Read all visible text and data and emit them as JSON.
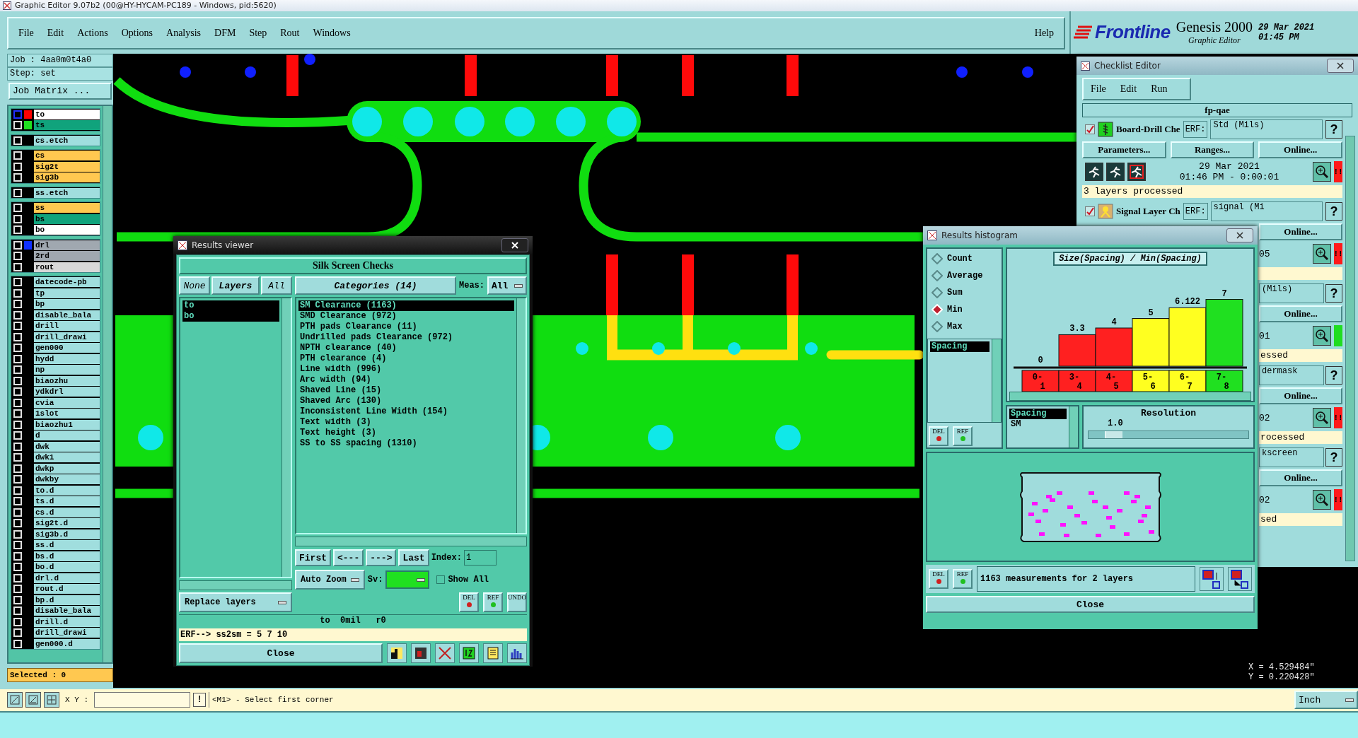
{
  "window": {
    "title": "Graphic Editor 9.07b2 (00@HY-HYCAM-PC189 - Windows, pid:5620)"
  },
  "menu": [
    "File",
    "Edit",
    "Actions",
    "Options",
    "Analysis",
    "DFM",
    "Step",
    "Rout",
    "Windows"
  ],
  "help_menu": "Help",
  "brand": {
    "logo": "Frontline",
    "product": "Genesis 2000",
    "subtitle": "Graphic Editor",
    "date": "29 Mar 2021",
    "time": "01:45 PM"
  },
  "job": {
    "job": "Job : 4aa0m0t4a0",
    "step": "Step: set",
    "matrix_button": "Job Matrix ..."
  },
  "layer_groups": [
    {
      "layers": [
        {
          "name": "to",
          "color": "#ffffff",
          "swatch": {
            "color": "#ff0000"
          },
          "selected": true
        },
        {
          "name": "ts",
          "color": "#10a37c",
          "swatch": {
            "color": "#20e020"
          },
          "selected": false
        }
      ]
    },
    {
      "layers": [
        {
          "name": "cs.etch",
          "color": "#a0dede",
          "selected": false
        }
      ]
    },
    {
      "layers": [
        {
          "name": "cs",
          "color": "#ffc850",
          "selected": false
        },
        {
          "name": "sig2t",
          "color": "#ffc850",
          "selected": false
        },
        {
          "name": "sig3b",
          "color": "#ffc850",
          "selected": false
        }
      ]
    },
    {
      "layers": [
        {
          "name": "ss.etch",
          "color": "#a0dede",
          "selected": false
        }
      ]
    },
    {
      "layers": [
        {
          "name": "ss",
          "color": "#ffc850",
          "selected": false
        },
        {
          "name": "bs",
          "color": "#10a37c",
          "selected": false
        },
        {
          "name": "bo",
          "color": "#ffffff",
          "selected": false
        }
      ]
    },
    {
      "layers": [
        {
          "name": "drl",
          "color": "#a0a8b0",
          "swatch": {
            "color": "#1030ff"
          },
          "selected": false
        },
        {
          "name": "2rd",
          "color": "#a0a8b0",
          "selected": false
        },
        {
          "name": "rout",
          "color": "#d8d8d8",
          "selected": false
        }
      ]
    },
    {
      "layers": [
        {
          "name": "datecode-pb",
          "color": "#a0dede",
          "selected": false
        },
        {
          "name": "tp",
          "color": "#a0dede",
          "selected": false
        },
        {
          "name": "bp",
          "color": "#a0dede",
          "selected": false
        },
        {
          "name": "disable_bala",
          "color": "#a0dede",
          "selected": false
        },
        {
          "name": "drill",
          "color": "#a0dede",
          "selected": false
        },
        {
          "name": "drill_drawi",
          "color": "#a0dede",
          "selected": false
        },
        {
          "name": "gen000",
          "color": "#a0dede",
          "selected": false
        },
        {
          "name": "hydd",
          "color": "#a0dede",
          "selected": false
        },
        {
          "name": "np",
          "color": "#a0dede",
          "selected": false
        },
        {
          "name": "biaozhu",
          "color": "#a0dede",
          "selected": false
        },
        {
          "name": "ydkdrl",
          "color": "#a0dede",
          "selected": false
        },
        {
          "name": "cvia",
          "color": "#a0dede",
          "selected": false
        },
        {
          "name": "1slot",
          "color": "#a0dede",
          "selected": false
        },
        {
          "name": "biaozhu1",
          "color": "#a0dede",
          "selected": false
        },
        {
          "name": "d",
          "color": "#a0dede",
          "selected": false
        },
        {
          "name": "dwk",
          "color": "#a0dede",
          "selected": false
        },
        {
          "name": "dwk1",
          "color": "#a0dede",
          "selected": false
        },
        {
          "name": "dwkp",
          "color": "#a0dede",
          "selected": false
        },
        {
          "name": "dwkby",
          "color": "#a0dede",
          "selected": false
        },
        {
          "name": "to.d",
          "color": "#a0dede",
          "selected": false
        },
        {
          "name": "ts.d",
          "color": "#a0dede",
          "selected": false
        },
        {
          "name": "cs.d",
          "color": "#a0dede",
          "selected": false
        },
        {
          "name": "sig2t.d",
          "color": "#a0dede",
          "selected": false
        },
        {
          "name": "sig3b.d",
          "color": "#a0dede",
          "selected": false
        },
        {
          "name": "ss.d",
          "color": "#a0dede",
          "selected": false
        },
        {
          "name": "bs.d",
          "color": "#a0dede",
          "selected": false
        },
        {
          "name": "bo.d",
          "color": "#a0dede",
          "selected": false
        },
        {
          "name": "drl.d",
          "color": "#a0dede",
          "selected": false
        },
        {
          "name": "rout.d",
          "color": "#a0dede",
          "selected": false
        },
        {
          "name": "bp.d",
          "color": "#a0dede",
          "selected": false
        },
        {
          "name": "disable_bala",
          "color": "#a0dede",
          "selected": false
        },
        {
          "name": "drill.d",
          "color": "#a0dede",
          "selected": false
        },
        {
          "name": "drill_drawi",
          "color": "#a0dede",
          "selected": false
        },
        {
          "name": "gen000.d",
          "color": "#a0dede",
          "selected": false
        }
      ]
    }
  ],
  "selected_count": "Selected : 0",
  "coordinates": [
    "X = 4.529484\"",
    "Y = 0.220428\""
  ],
  "results_viewer": {
    "title": "Results viewer",
    "heading": "Silk Screen Checks",
    "layer_buttons": [
      "None",
      "Layers",
      "All"
    ],
    "layers": [
      {
        "name": "to",
        "selected": true
      },
      {
        "name": "bo",
        "selected": true
      }
    ],
    "categories_button": "Categories (14)",
    "meas_label": "Meas:",
    "meas_value": "All",
    "categories": [
      {
        "label": "SM Clearance (1163)",
        "selected": true
      },
      {
        "label": "SMD Clearance (972)",
        "selected": false
      },
      {
        "label": "PTH pads Clearance (11)",
        "selected": false
      },
      {
        "label": "Undrilled pads Clearance (972)",
        "selected": false
      },
      {
        "label": "NPTH clearance (40)",
        "selected": false
      },
      {
        "label": "PTH clearance (4)",
        "selected": false
      },
      {
        "label": "Line width (996)",
        "selected": false
      },
      {
        "label": "Arc width (94)",
        "selected": false
      },
      {
        "label": "Shaved Line (15)",
        "selected": false
      },
      {
        "label": "Shaved Arc (130)",
        "selected": false
      },
      {
        "label": "Inconsistent Line Width (154)",
        "selected": false
      },
      {
        "label": "Text width (3)",
        "selected": false
      },
      {
        "label": "Text height (3)",
        "selected": false
      },
      {
        "label": "SS to SS spacing (1310)",
        "selected": false
      }
    ],
    "nav_buttons": [
      "First",
      "<---",
      "--->",
      "Last"
    ],
    "index_label": "Index:",
    "index_value": "1",
    "zoom_mode": "Auto Zoom",
    "sv": {
      "label": "Sv:",
      "color": "#20e020"
    },
    "show_all": {
      "label": "Show All",
      "checked": false
    },
    "replace_mode": "Replace layers",
    "tool_buttons": [
      "DEL",
      "REF",
      "UNDO"
    ],
    "info_line": "to  0mil   r0",
    "erf_line": "ERF--> ss2sm = 5 7 10",
    "close_button": "Close"
  },
  "histogram": {
    "title": "Results histogram",
    "modes": [
      {
        "label": "Count",
        "selected": false
      },
      {
        "label": "Average",
        "selected": false
      },
      {
        "label": "Sum",
        "selected": false
      },
      {
        "label": "Min",
        "selected": true
      },
      {
        "label": "Max",
        "selected": false
      }
    ],
    "measures": [
      {
        "label": "Spacing",
        "selected": true
      }
    ],
    "list_buttons": [
      "DEL",
      "REF"
    ],
    "chart_data": {
      "type": "bar",
      "title": "Size(Spacing) / Min(Spacing)",
      "categories": [
        "0-1",
        "3-4",
        "4-5",
        "5-6",
        "6-7",
        "7-8"
      ],
      "values": [
        0,
        3.3,
        4,
        5,
        6.122,
        7
      ],
      "colors": [
        "#ff2020",
        "#ff2020",
        "#ff2020",
        "#ffff20",
        "#ffff20",
        "#20e020"
      ],
      "data_labels": true
    },
    "types": [
      {
        "label": "Spacing",
        "selected": true
      },
      {
        "label": "SM",
        "selected": false
      }
    ],
    "resolution_label": "Resolution",
    "resolution_value": "1.0",
    "resolution_slider": {
      "level": 0.1
    },
    "preview_buttons": [
      "DEL",
      "REF"
    ],
    "summary": "1163 measurements for 2 layers",
    "close_button": "Close"
  },
  "checklist": {
    "title": "Checklist Editor",
    "menu": [
      "File",
      "Edit",
      "Run"
    ],
    "name": "fp-qae",
    "checks": [
      {
        "checked": true,
        "kind": "drill",
        "name": "Board-Drill Che",
        "erf_label": "ERF:",
        "erf_value": "Std (Mils)",
        "help": "?",
        "buttons": [
          "Parameters...",
          "Ranges...",
          "Online..."
        ],
        "date": "29 Mar 2021",
        "time": "01:46 PM - 0:00:01",
        "failed": true,
        "flag": "!!",
        "result": "3 layers processed"
      },
      {
        "checked": true,
        "kind": "signal",
        "name": "Signal Layer Ch",
        "erf_label": "ERF:",
        "erf_value": "signal (Mi",
        "help": "?",
        "buttons": [
          "Online..."
        ],
        "time": "05",
        "failed": true,
        "flag": "!!"
      },
      {
        "erf_value": "(Mils)",
        "help": "?",
        "buttons": [
          "Online..."
        ],
        "time": "01",
        "failed": false,
        "result": "essed"
      },
      {
        "erf_value": "dermask",
        "help": "?",
        "buttons": [
          "Online..."
        ],
        "time": "02",
        "failed": true,
        "flag": "!!",
        "result": "rocessed"
      },
      {
        "erf_value": "kscreen",
        "help": "?",
        "buttons": [
          "Online..."
        ],
        "time": "02",
        "failed": true,
        "flag": "!!",
        "result": "sed"
      }
    ]
  },
  "status_bar": {
    "xy_label": "X Y :",
    "alert_button": "!",
    "prompt": "<M1> - Select first corner",
    "units": "Inch"
  }
}
